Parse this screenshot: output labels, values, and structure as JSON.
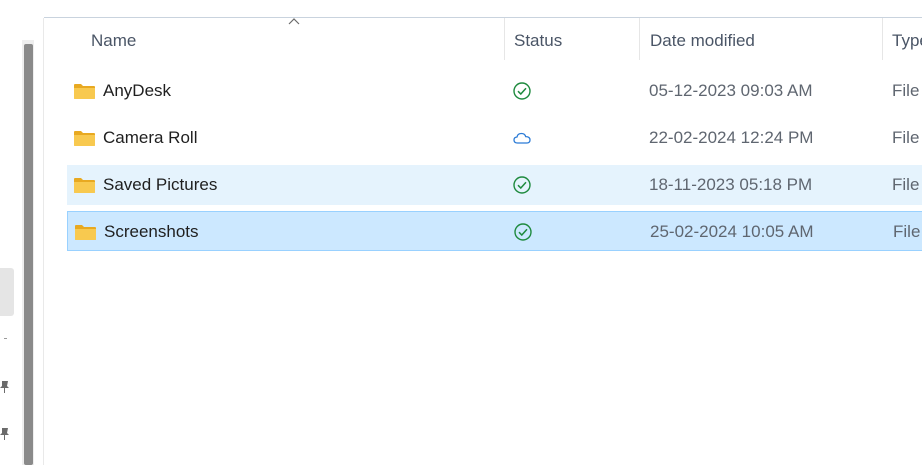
{
  "columns": {
    "name": "Name",
    "status": "Status",
    "date_modified": "Date modified",
    "type": "Type"
  },
  "rows": [
    {
      "name": "AnyDesk",
      "status_icon": "sync-ok-icon",
      "date": "05-12-2023 09:03 AM",
      "type": "File"
    },
    {
      "name": "Camera Roll",
      "status_icon": "cloud-icon",
      "date": "22-02-2024 12:24 PM",
      "type": "File"
    },
    {
      "name": "Saved Pictures",
      "status_icon": "sync-ok-icon",
      "date": "18-11-2023 05:18 PM",
      "type": "File"
    },
    {
      "name": "Screenshots",
      "status_icon": "sync-ok-icon",
      "date": "25-02-2024 10:05 AM",
      "type": "File"
    }
  ],
  "row_states": [
    "normal",
    "normal",
    "hover",
    "selected"
  ],
  "colors": {
    "hover_row": "#e5f3fd",
    "selected_row": "#cce8ff",
    "selected_border": "#99d1ff",
    "sync_ok": "#1e8a3e",
    "cloud": "#2b7bd6",
    "folder": "#f4c24a"
  }
}
